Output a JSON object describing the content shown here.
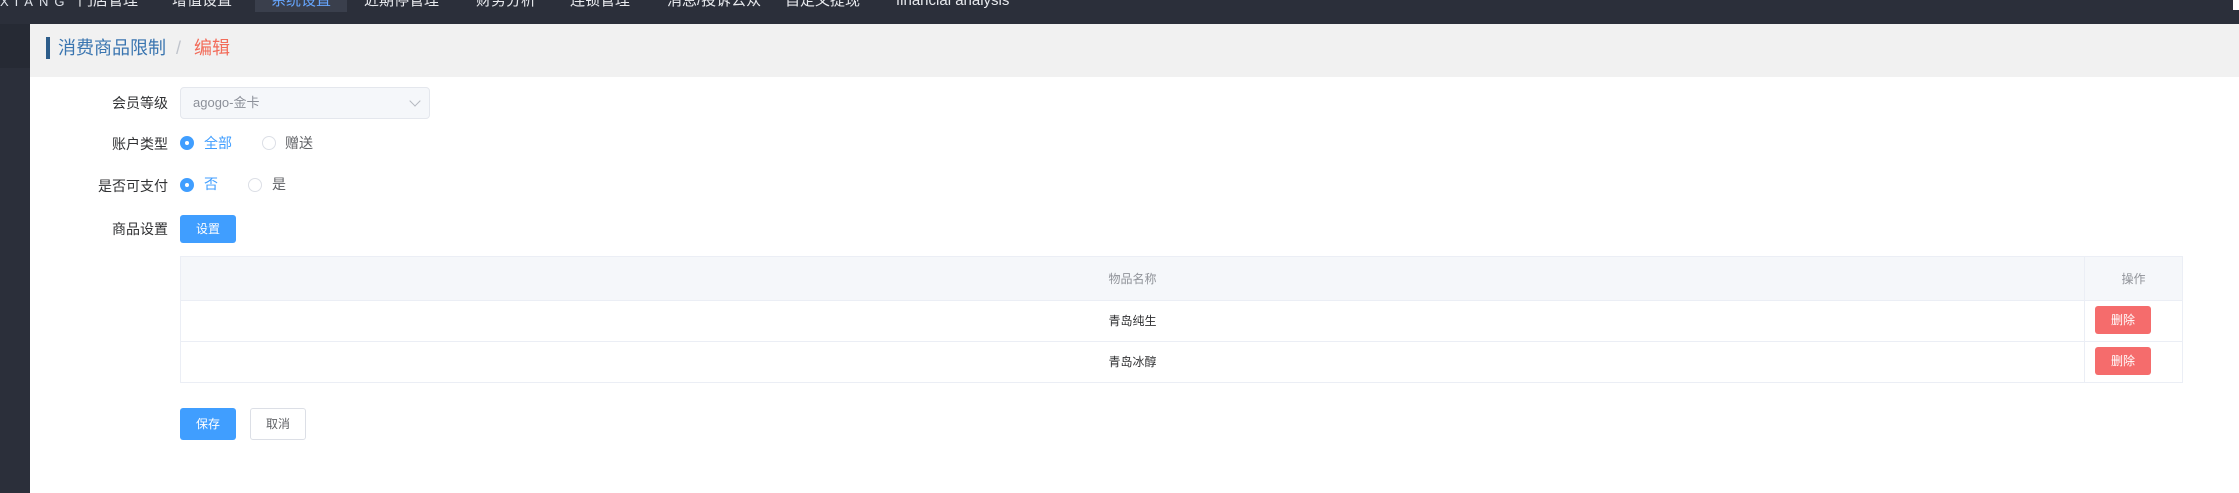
{
  "nav": {
    "logo": "XIANG",
    "items": [
      "门店管理",
      "增值设置",
      "系统设置",
      "近期停管理",
      "财务分析",
      "连锁管理",
      "消息/投诉公众",
      "自定义提现",
      "financial analysis"
    ],
    "active_index": 2
  },
  "breadcrumb": {
    "parent": "消费商品限制",
    "separator": "/",
    "current": "编辑"
  },
  "form": {
    "member_level": {
      "label": "会员等级",
      "value": "agogo-金卡"
    },
    "account_type": {
      "label": "账户类型",
      "options": [
        "全部",
        "赠送"
      ],
      "selected": "全部"
    },
    "payable": {
      "label": "是否可支付",
      "options": [
        "否",
        "是"
      ],
      "selected": "否"
    },
    "goods": {
      "label": "商品设置",
      "set_button": "设置"
    }
  },
  "table": {
    "headers": [
      "物品名称",
      "操作"
    ],
    "rows": [
      {
        "name": "青岛纯生",
        "action": "删除"
      },
      {
        "name": "青岛冰醇",
        "action": "删除"
      }
    ]
  },
  "actions": {
    "save": "保存",
    "cancel": "取消"
  },
  "colors": {
    "primary": "#409eff",
    "danger": "#f56c6c",
    "nav_bg": "#2b2f3a",
    "crumb_current": "#f26c5a"
  }
}
